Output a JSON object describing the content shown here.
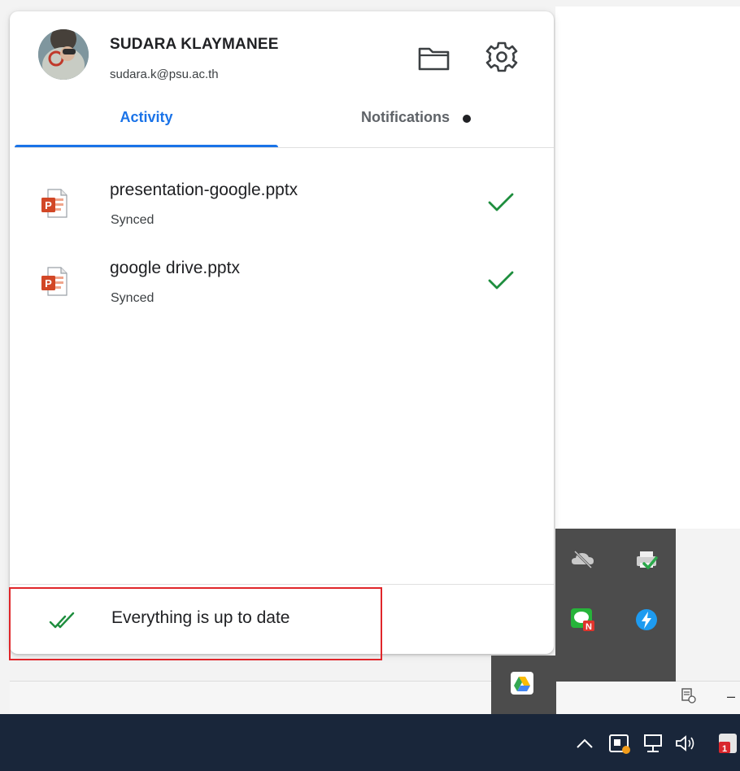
{
  "account": {
    "name": "SUDARA KLAYMANEE",
    "email": "sudara.k@psu.ac.th"
  },
  "toolbar": {
    "folder_icon": "folder-icon",
    "settings_icon": "gear-icon"
  },
  "tabs": [
    {
      "label": "Activity",
      "selected": true
    },
    {
      "label": "Notifications",
      "selected": false,
      "has_unread_dot": true
    }
  ],
  "files": [
    {
      "name": "presentation-google.pptx",
      "status": "Synced",
      "icon": "powerpoint-file-icon"
    },
    {
      "name": "google drive.pptx",
      "status": "Synced",
      "icon": "powerpoint-file-icon"
    }
  ],
  "footer": {
    "status_text": "Everything is up to date",
    "status_icon": "double-check-icon"
  },
  "colors": {
    "accent": "#1a73e8",
    "success": "#1e8e3e",
    "highlight": "#e0262a",
    "taskbar": "#19263a",
    "tray": "#4c4c4c"
  },
  "tray_icons": [
    "onedrive-offline-icon",
    "printer-check-icon",
    "line-messenger-icon",
    "lightning-app-icon",
    "google-drive-icon"
  ],
  "taskbar_icons": [
    "chevron-up-icon",
    "notification-icon",
    "network-icon",
    "volume-icon",
    "app-badge-icon"
  ]
}
